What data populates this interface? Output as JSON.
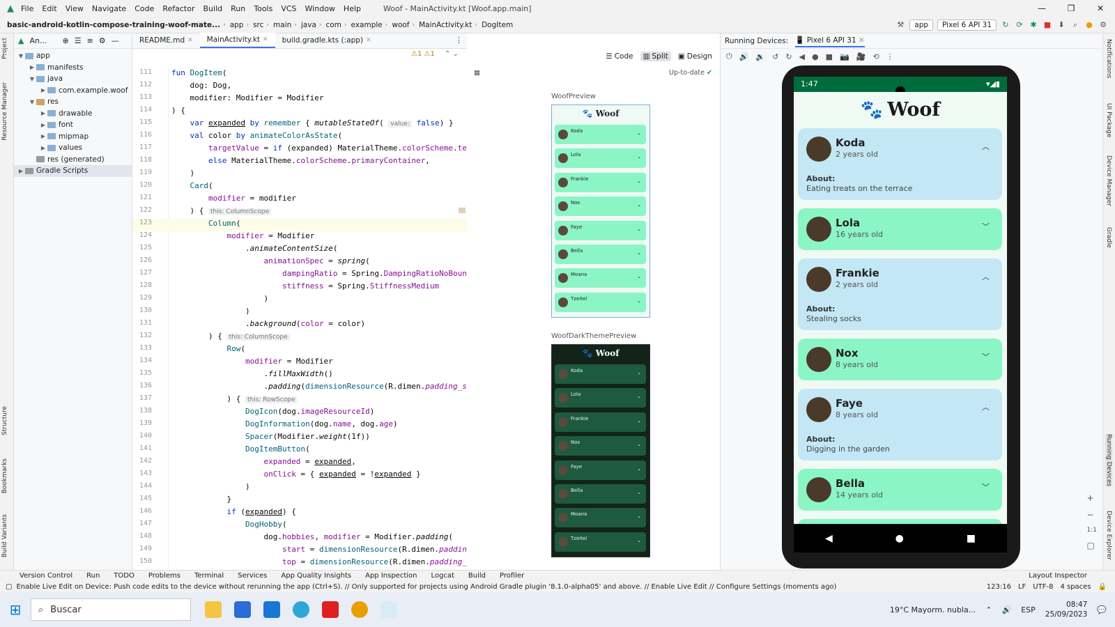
{
  "titlebar": {
    "menu": [
      "File",
      "Edit",
      "View",
      "Navigate",
      "Code",
      "Refactor",
      "Build",
      "Run",
      "Tools",
      "VCS",
      "Window",
      "Help"
    ],
    "title": "Woof - MainActivity.kt [Woof.app.main]"
  },
  "breadcrumb": [
    "basic-android-kotlin-compose-training-woof-mate...",
    "app",
    "src",
    "main",
    "java",
    "com",
    "example",
    "woof",
    "MainActivity.kt",
    "DogItem"
  ],
  "toolbar": {
    "run_config": "app",
    "device": "Pixel 6 API 31"
  },
  "project": {
    "header": "An...",
    "tree": [
      {
        "label": "app",
        "depth": 0,
        "kind": "folder"
      },
      {
        "label": "manifests",
        "depth": 1,
        "kind": "folder"
      },
      {
        "label": "java",
        "depth": 1,
        "kind": "folder"
      },
      {
        "label": "com.example.woof",
        "depth": 2,
        "kind": "folder"
      },
      {
        "label": "res",
        "depth": 1,
        "kind": "res"
      },
      {
        "label": "drawable",
        "depth": 2,
        "kind": "folder"
      },
      {
        "label": "font",
        "depth": 2,
        "kind": "folder"
      },
      {
        "label": "mipmap",
        "depth": 2,
        "kind": "folder"
      },
      {
        "label": "values",
        "depth": 2,
        "kind": "folder"
      },
      {
        "label": "res (generated)",
        "depth": 1,
        "kind": "gray"
      },
      {
        "label": "Gradle Scripts",
        "depth": 0,
        "kind": "gray"
      }
    ]
  },
  "editor_tabs": [
    "README.md",
    "MainActivity.kt",
    "build.gradle.kts (:app)"
  ],
  "warnings": "⚠1 ⚠1",
  "preview_modes": [
    "Code",
    "Split",
    "Design"
  ],
  "preview_status": "Up-to-date",
  "code_lines": [
    {
      "n": "111",
      "html": "<span class='kw'>fun</span> <span class='fn'>DogItem</span>("
    },
    {
      "n": "112",
      "html": "    dog: Dog,"
    },
    {
      "n": "113",
      "html": "    modifier: Modifier = Modifier"
    },
    {
      "n": "114",
      "html": ") {"
    },
    {
      "n": "115",
      "html": "    <span class='kw'>var</span> <u>expanded</u> <span class='kw'>by</span> <span class='fn'>remember</span> { <span class='it'>mutableStateOf</span>( <span class='hint'>value:</span> <span class='kw'>false</span>) }"
    },
    {
      "n": "116",
      "html": "    <span class='kw'>val</span> color <span class='kw'>by</span> <span class='fn'>animateColorAsState</span>("
    },
    {
      "n": "117",
      "html": "        <span class='pr'>targetValue</span> = <span class='kw'>if</span> (expanded) MaterialTheme.<span class='pr'>colorScheme</span>.<span class='pr'>ter</span>"
    },
    {
      "n": "118",
      "html": "        <span class='kw'>else</span> MaterialTheme.<span class='pr'>colorScheme</span>.<span class='pr'>primaryContainer</span>,"
    },
    {
      "n": "119",
      "html": "    )"
    },
    {
      "n": "120",
      "html": "    <span class='fn'>Card</span>("
    },
    {
      "n": "121",
      "html": "        <span class='pr'>modifier</span> = modifier"
    },
    {
      "n": "122",
      "html": "    ) { <span class='hint'>this: ColumnScope</span>"
    },
    {
      "n": "123",
      "html": "        <span class='fn'>Column</span>("
    },
    {
      "n": "124",
      "html": "            <span class='pr'>modifier</span> = Modifier"
    },
    {
      "n": "125",
      "html": "                .<span class='it'>animateContentSize</span>("
    },
    {
      "n": "126",
      "html": "                    <span class='pr'>animationSpec</span> = <span class='it'>spring</span>("
    },
    {
      "n": "127",
      "html": "                        <span class='pr'>dampingRatio</span> = Spring.<span class='pr'>DampingRatioNoBounc</span>"
    },
    {
      "n": "128",
      "html": "                        <span class='pr'>stiffness</span> = Spring.<span class='pr'>StiffnessMedium</span>"
    },
    {
      "n": "129",
      "html": "                    )"
    },
    {
      "n": "130",
      "html": "                )"
    },
    {
      "n": "131",
      "html": "                .<span class='it'>background</span>(<span class='pr'>color</span> = color)"
    },
    {
      "n": "132",
      "html": "        ) { <span class='hint'>this: ColumnScope</span>"
    },
    {
      "n": "133",
      "html": "            <span class='fn'>Row</span>("
    },
    {
      "n": "134",
      "html": "                <span class='pr'>modifier</span> = Modifier"
    },
    {
      "n": "135",
      "html": "                    .<span class='it'>fillMaxWidth</span>()"
    },
    {
      "n": "136",
      "html": "                    .<span class='it'>padding</span>(<span class='fn'>dimensionResource</span>(R.dimen.<span class='pr it'>padding_sm</span>"
    },
    {
      "n": "137",
      "html": "            ) { <span class='hint'>this: RowScope</span>"
    },
    {
      "n": "138",
      "html": "                <span class='fn'>DogIcon</span>(dog.<span class='pr'>imageResourceId</span>)"
    },
    {
      "n": "139",
      "html": "                <span class='fn'>DogInformation</span>(dog.<span class='pr'>name</span>, dog.<span class='pr'>age</span>)"
    },
    {
      "n": "140",
      "html": "                <span class='fn'>Spacer</span>(Modifier.<span class='it'>weight</span>(1f))"
    },
    {
      "n": "141",
      "html": "                <span class='fn'>DogItemButton</span>("
    },
    {
      "n": "142",
      "html": "                    <span class='pr'>expanded</span> = <u>expanded</u>,"
    },
    {
      "n": "143",
      "html": "                    <span class='pr'>onClick</span> = { <u>expanded</u> = !<u>expanded</u> }"
    },
    {
      "n": "144",
      "html": "                )"
    },
    {
      "n": "145",
      "html": "            }"
    },
    {
      "n": "146",
      "html": "            <span class='kw'>if</span> (<u>expanded</u>) {"
    },
    {
      "n": "147",
      "html": "                <span class='fn'>DogHobby</span>("
    },
    {
      "n": "148",
      "html": "                    dog.<span class='pr'>hobbies</span>, <span class='pr'>modifier</span> = Modifier.<span class='it'>padding</span>("
    },
    {
      "n": "149",
      "html": "                        <span class='pr'>start</span> = <span class='fn'>dimensionResource</span>(R.dimen.<span class='pr it'>paddinc</span>"
    },
    {
      "n": "150",
      "html": "                        <span class='pr'>top</span> = <span class='fn'>dimensionResource</span>(R.dimen.<span class='pr it'>padding_s</span>"
    }
  ],
  "previews": {
    "light_label": "WoofPreview",
    "dark_label": "WoofDarkThemePreview",
    "app_title": "Woof",
    "dogs": [
      "Koda",
      "Lola",
      "Frankie",
      "Nox",
      "Faye",
      "Bella",
      "Moana",
      "Tzeitel"
    ]
  },
  "device_pane": {
    "header": "Running Devices:",
    "device_tab": "Pixel 6 API 31"
  },
  "phone": {
    "time": "1:47",
    "app_title": "Woof",
    "cards": [
      {
        "name": "Koda",
        "age": "2 years old",
        "expanded": true,
        "about": "About:",
        "hobby": "Eating treats on the terrace"
      },
      {
        "name": "Lola",
        "age": "16 years old",
        "expanded": false
      },
      {
        "name": "Frankie",
        "age": "2 years old",
        "expanded": true,
        "about": "About:",
        "hobby": "Stealing socks"
      },
      {
        "name": "Nox",
        "age": "8 years old",
        "expanded": false
      },
      {
        "name": "Faye",
        "age": "8 years old",
        "expanded": true,
        "about": "About:",
        "hobby": "Digging in the garden"
      },
      {
        "name": "Bella",
        "age": "14 years old",
        "expanded": false
      }
    ]
  },
  "bottom_tabs": [
    "Version Control",
    "Run",
    "TODO",
    "Problems",
    "Terminal",
    "Services",
    "App Quality Insights",
    "App Inspection",
    "Logcat",
    "Build",
    "Profiler"
  ],
  "layout_inspector": "Layout Inspector",
  "status_message": "Enable Live Edit on Device: Push code edits to the device without rerunning the app (Ctrl+S). // Only supported for projects using Android Gradle plugin '8.1.0-alpha05' and above. // Enable Live Edit // Configure Settings (moments ago)",
  "status_right": [
    "123:16",
    "LF",
    "UTF-8",
    "4 spaces"
  ],
  "taskbar": {
    "search": "Buscar",
    "weather": "19°C  Mayorm. nubla...",
    "lang": "ESP",
    "time": "08:47",
    "date": "25/09/2023"
  },
  "left_tabs": [
    "Project",
    "Resource Manager",
    "Structure",
    "Bookmarks",
    "Build Variants"
  ],
  "right_tabs": [
    "Notifications",
    "UI Package",
    "Device Manager",
    "Gradle",
    "Running Devices",
    "Device Explorer"
  ],
  "colors": {
    "expanded_card": "#c4e7f5",
    "collapsed_card": "#8bf5c6",
    "dark_card": "#1d5a3e",
    "status_bar": "#006b3c"
  }
}
